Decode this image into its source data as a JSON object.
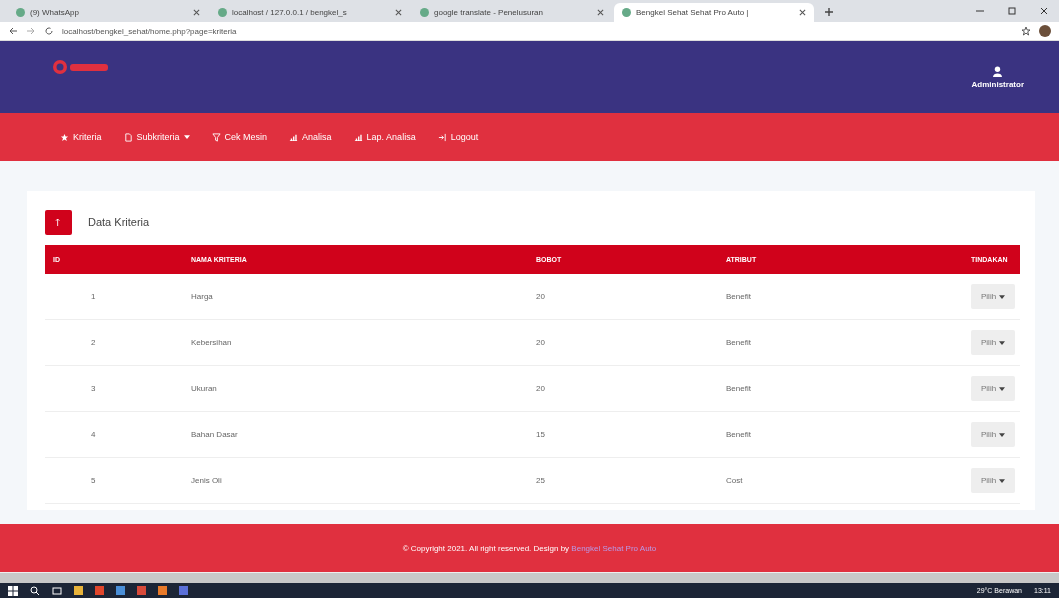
{
  "browser": {
    "tabs": [
      {
        "title": "(9) WhatsApp",
        "selected": false
      },
      {
        "title": "localhost / 127.0.0.1 / bengkel_s",
        "selected": false
      },
      {
        "title": "google translate - Penelusuran",
        "selected": false
      },
      {
        "title": "Bengkel Sehat Sehat Pro Auto |",
        "selected": true
      }
    ],
    "url": "localhost/bengkel_sehat/home.php?page=kriteria"
  },
  "header": {
    "user": "Administrator"
  },
  "nav": [
    {
      "label": "Kriteria",
      "dropdown": false
    },
    {
      "label": "Subkriteria",
      "dropdown": true
    },
    {
      "label": "Cek Mesin",
      "dropdown": false
    },
    {
      "label": "Analisa",
      "dropdown": false
    },
    {
      "label": "Lap. Analisa",
      "dropdown": false
    },
    {
      "label": "Logout",
      "dropdown": false
    }
  ],
  "panel": {
    "title": "Data Kriteria",
    "columns": [
      "ID",
      "NAMA KRITERIA",
      "BOBOT",
      "ATRIBUT",
      "TINDAKAN"
    ],
    "rows": [
      {
        "id": "1",
        "name": "Harga",
        "weight": "20",
        "attribute": "Benefit",
        "action": "Pilih"
      },
      {
        "id": "2",
        "name": "Kebersihan",
        "weight": "20",
        "attribute": "Benefit",
        "action": "Pilih"
      },
      {
        "id": "3",
        "name": "Ukuran",
        "weight": "20",
        "attribute": "Benefit",
        "action": "Pilih"
      },
      {
        "id": "4",
        "name": "Bahan Dasar",
        "weight": "15",
        "attribute": "Benefit",
        "action": "Pilih"
      },
      {
        "id": "5",
        "name": "Jenis Oli",
        "weight": "25",
        "attribute": "Cost",
        "action": "Pilih"
      }
    ]
  },
  "footer": {
    "text": "© Copyright 2021. All right reserved. Design by",
    "link": "Bengkel Sehat Pro Auto"
  },
  "taskbar": {
    "weather": "29°C Berawan",
    "time": "13:11"
  }
}
